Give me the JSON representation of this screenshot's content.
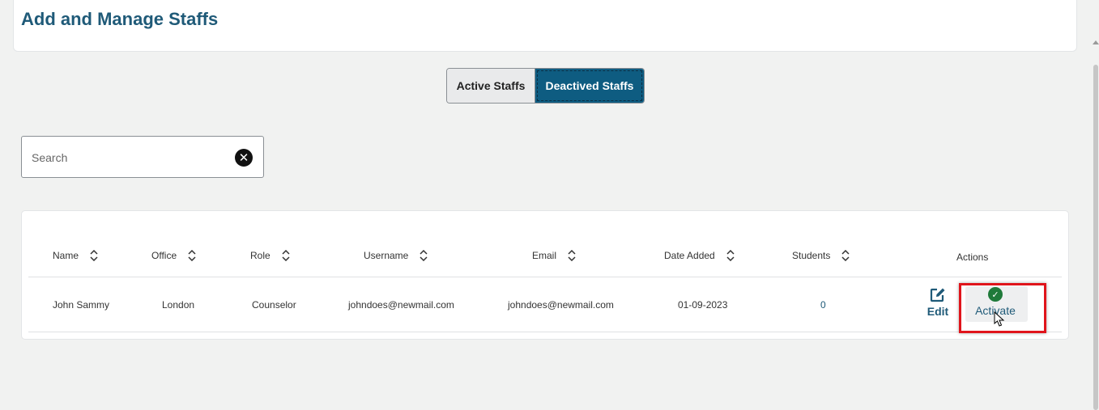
{
  "page": {
    "title": "Add and Manage Staffs"
  },
  "tabs": {
    "active_label": "Active Staffs",
    "deactivated_label": "Deactived Staffs"
  },
  "search": {
    "placeholder": "Search",
    "value": ""
  },
  "table": {
    "columns": [
      "Name",
      "Office",
      "Role",
      "Username",
      "Email",
      "Date Added",
      "Students",
      "Actions"
    ],
    "rows": [
      {
        "name": "John Sammy",
        "office": "London",
        "role": "Counselor",
        "username": "johndoes@newmail.com",
        "email": "johndoes@newmail.com",
        "date_added": "01-09-2023",
        "students": "0"
      }
    ],
    "row_actions": {
      "edit_label": "Edit",
      "activate_label": "Activate"
    }
  },
  "icons": {
    "search_clear": "close-circle-icon",
    "sort": "sort-updown-icon",
    "edit": "edit-pencil-icon",
    "activate": "check-circle-icon"
  },
  "colors": {
    "title": "#1f5a78",
    "selected_tab": "#0e5c81",
    "activate_check": "#1f7a3a",
    "highlight": "#e0141b"
  }
}
